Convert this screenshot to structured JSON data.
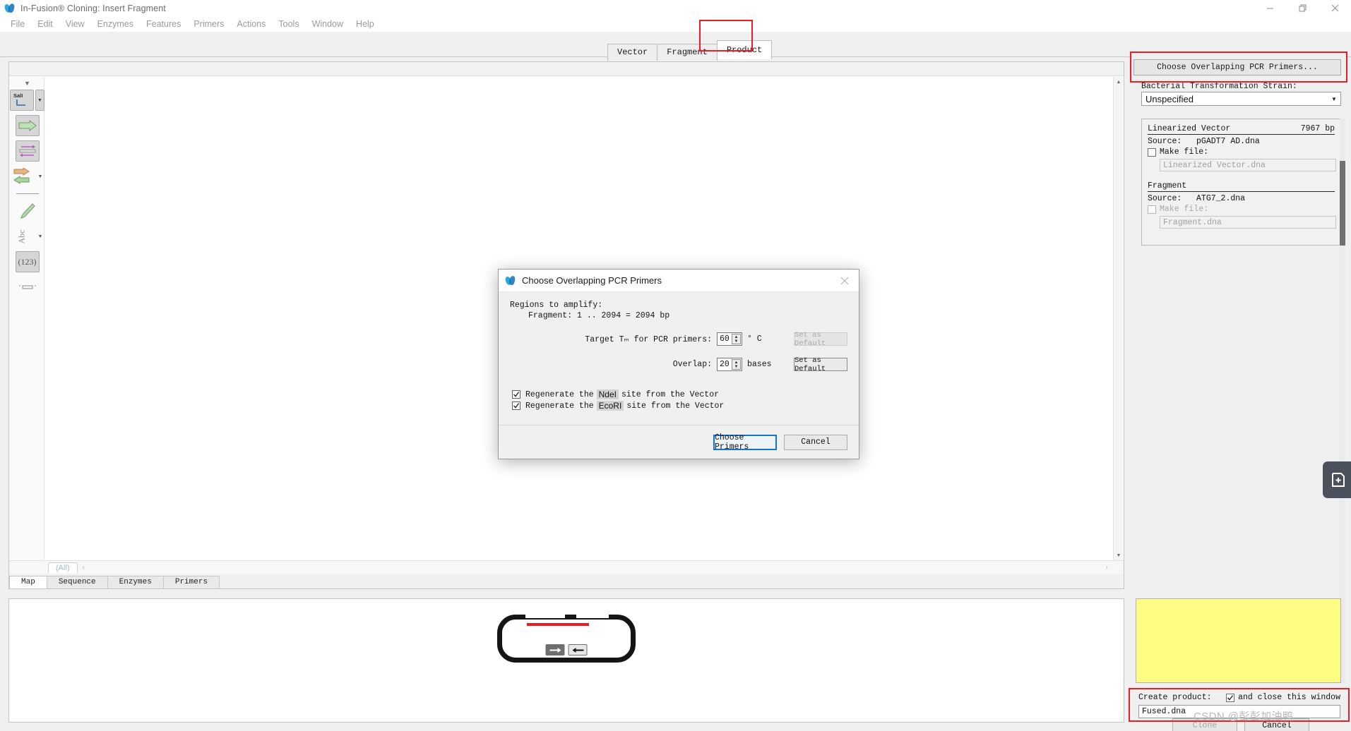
{
  "window": {
    "title": "In-Fusion® Cloning: Insert Fragment",
    "app_icon": "infusion-logo-icon",
    "controls": {
      "minimize": "minimize-icon",
      "restore": "restore-icon",
      "close": "close-icon"
    }
  },
  "menubar": {
    "items": [
      "File",
      "Edit",
      "View",
      "Enzymes",
      "Features",
      "Primers",
      "Actions",
      "Tools",
      "Window",
      "Help"
    ]
  },
  "tabs": {
    "items": [
      {
        "label": "Vector",
        "active": false
      },
      {
        "label": "Fragment",
        "active": false
      },
      {
        "label": "Product",
        "active": true
      }
    ],
    "highlight_color": "#ee1c25"
  },
  "editor": {
    "all_chip": "(All)",
    "chev_left": "‹",
    "chev_right": "›",
    "bottom_tabs": [
      {
        "label": "Map",
        "active": true
      },
      {
        "label": "Sequence",
        "active": false
      },
      {
        "label": "Enzymes",
        "active": false
      },
      {
        "label": "Primers",
        "active": false
      }
    ],
    "toolbar": [
      {
        "name": "enzyme-sali-tool",
        "label": "SalI"
      },
      {
        "name": "feature-arrow-tool",
        "label": ""
      },
      {
        "name": "primer-pair-tool",
        "label": ""
      },
      {
        "name": "orf-arrows-tool",
        "label": ""
      },
      {
        "name": "highlight-pen-tool",
        "label": ""
      },
      {
        "name": "abc-text-tool",
        "label": "Abc"
      },
      {
        "name": "numbering-tool",
        "label": "(123)"
      },
      {
        "name": "ruler-tool",
        "label": ""
      }
    ]
  },
  "map_panel": {
    "shape": "linearized-plasmid",
    "accent_color": "#ef1b1b",
    "arrow_right": "→",
    "arrow_left": "←"
  },
  "right_panel": {
    "choose_primers_button": "Choose Overlapping PCR Primers...",
    "strain_label": "Bacterial Transformation Strain:",
    "strain_value": "Unspecified",
    "strain_caret": "▼",
    "linearized_vector": {
      "title": "Linearized Vector",
      "size": "7967 bp",
      "source_label": "Source:",
      "source_value": "pGADT7 AD.dna",
      "make_file_label": "Make file:",
      "make_file_checked": false,
      "file_name": "Linearized Vector.dna"
    },
    "fragment": {
      "title": "Fragment",
      "source_label": "Source:",
      "source_value": "ATG7_2.dna",
      "make_file_label": "Make file:",
      "make_file_checked": false,
      "file_name": "Fragment.dna"
    },
    "note_color": "#fdfd83",
    "create_product": {
      "label": "Create product:",
      "close_window_label": "and close this window",
      "close_window_checked": true,
      "product_name": "Fused.dna"
    },
    "footer_buttons": [
      {
        "label": "Clone",
        "enabled": false
      },
      {
        "label": "Cancel",
        "enabled": true
      }
    ],
    "float_button_icon": "add-page-icon"
  },
  "dialog": {
    "title": "Choose Overlapping PCR Primers",
    "icon": "infusion-logo-icon",
    "close_icon": "close-icon",
    "regions_label": "Regions to amplify:",
    "fragment_line": "Fragment:  1 .. 2094  =  2094 bp",
    "tm_label": "Target Tₘ for PCR primers:",
    "tm_value": "60",
    "tm_unit": "° C",
    "tm_set_default": "Set as Default",
    "tm_set_default_enabled": false,
    "overlap_label": "Overlap:",
    "overlap_value": "20",
    "overlap_unit": "bases",
    "overlap_set_default": "Set as Default",
    "overlap_set_default_enabled": true,
    "spin_up": "▲",
    "spin_down": "▼",
    "checkboxes": [
      {
        "pre": "Regenerate the",
        "enzyme": "NdeI",
        "post": "site from the Vector",
        "checked": true
      },
      {
        "pre": "Regenerate the",
        "enzyme": "EcoRI",
        "post": "site from the Vector",
        "checked": true
      }
    ],
    "primary_button": "Choose Primers",
    "secondary_button": "Cancel"
  },
  "watermark": "CSDN @彭彭加油鸭"
}
